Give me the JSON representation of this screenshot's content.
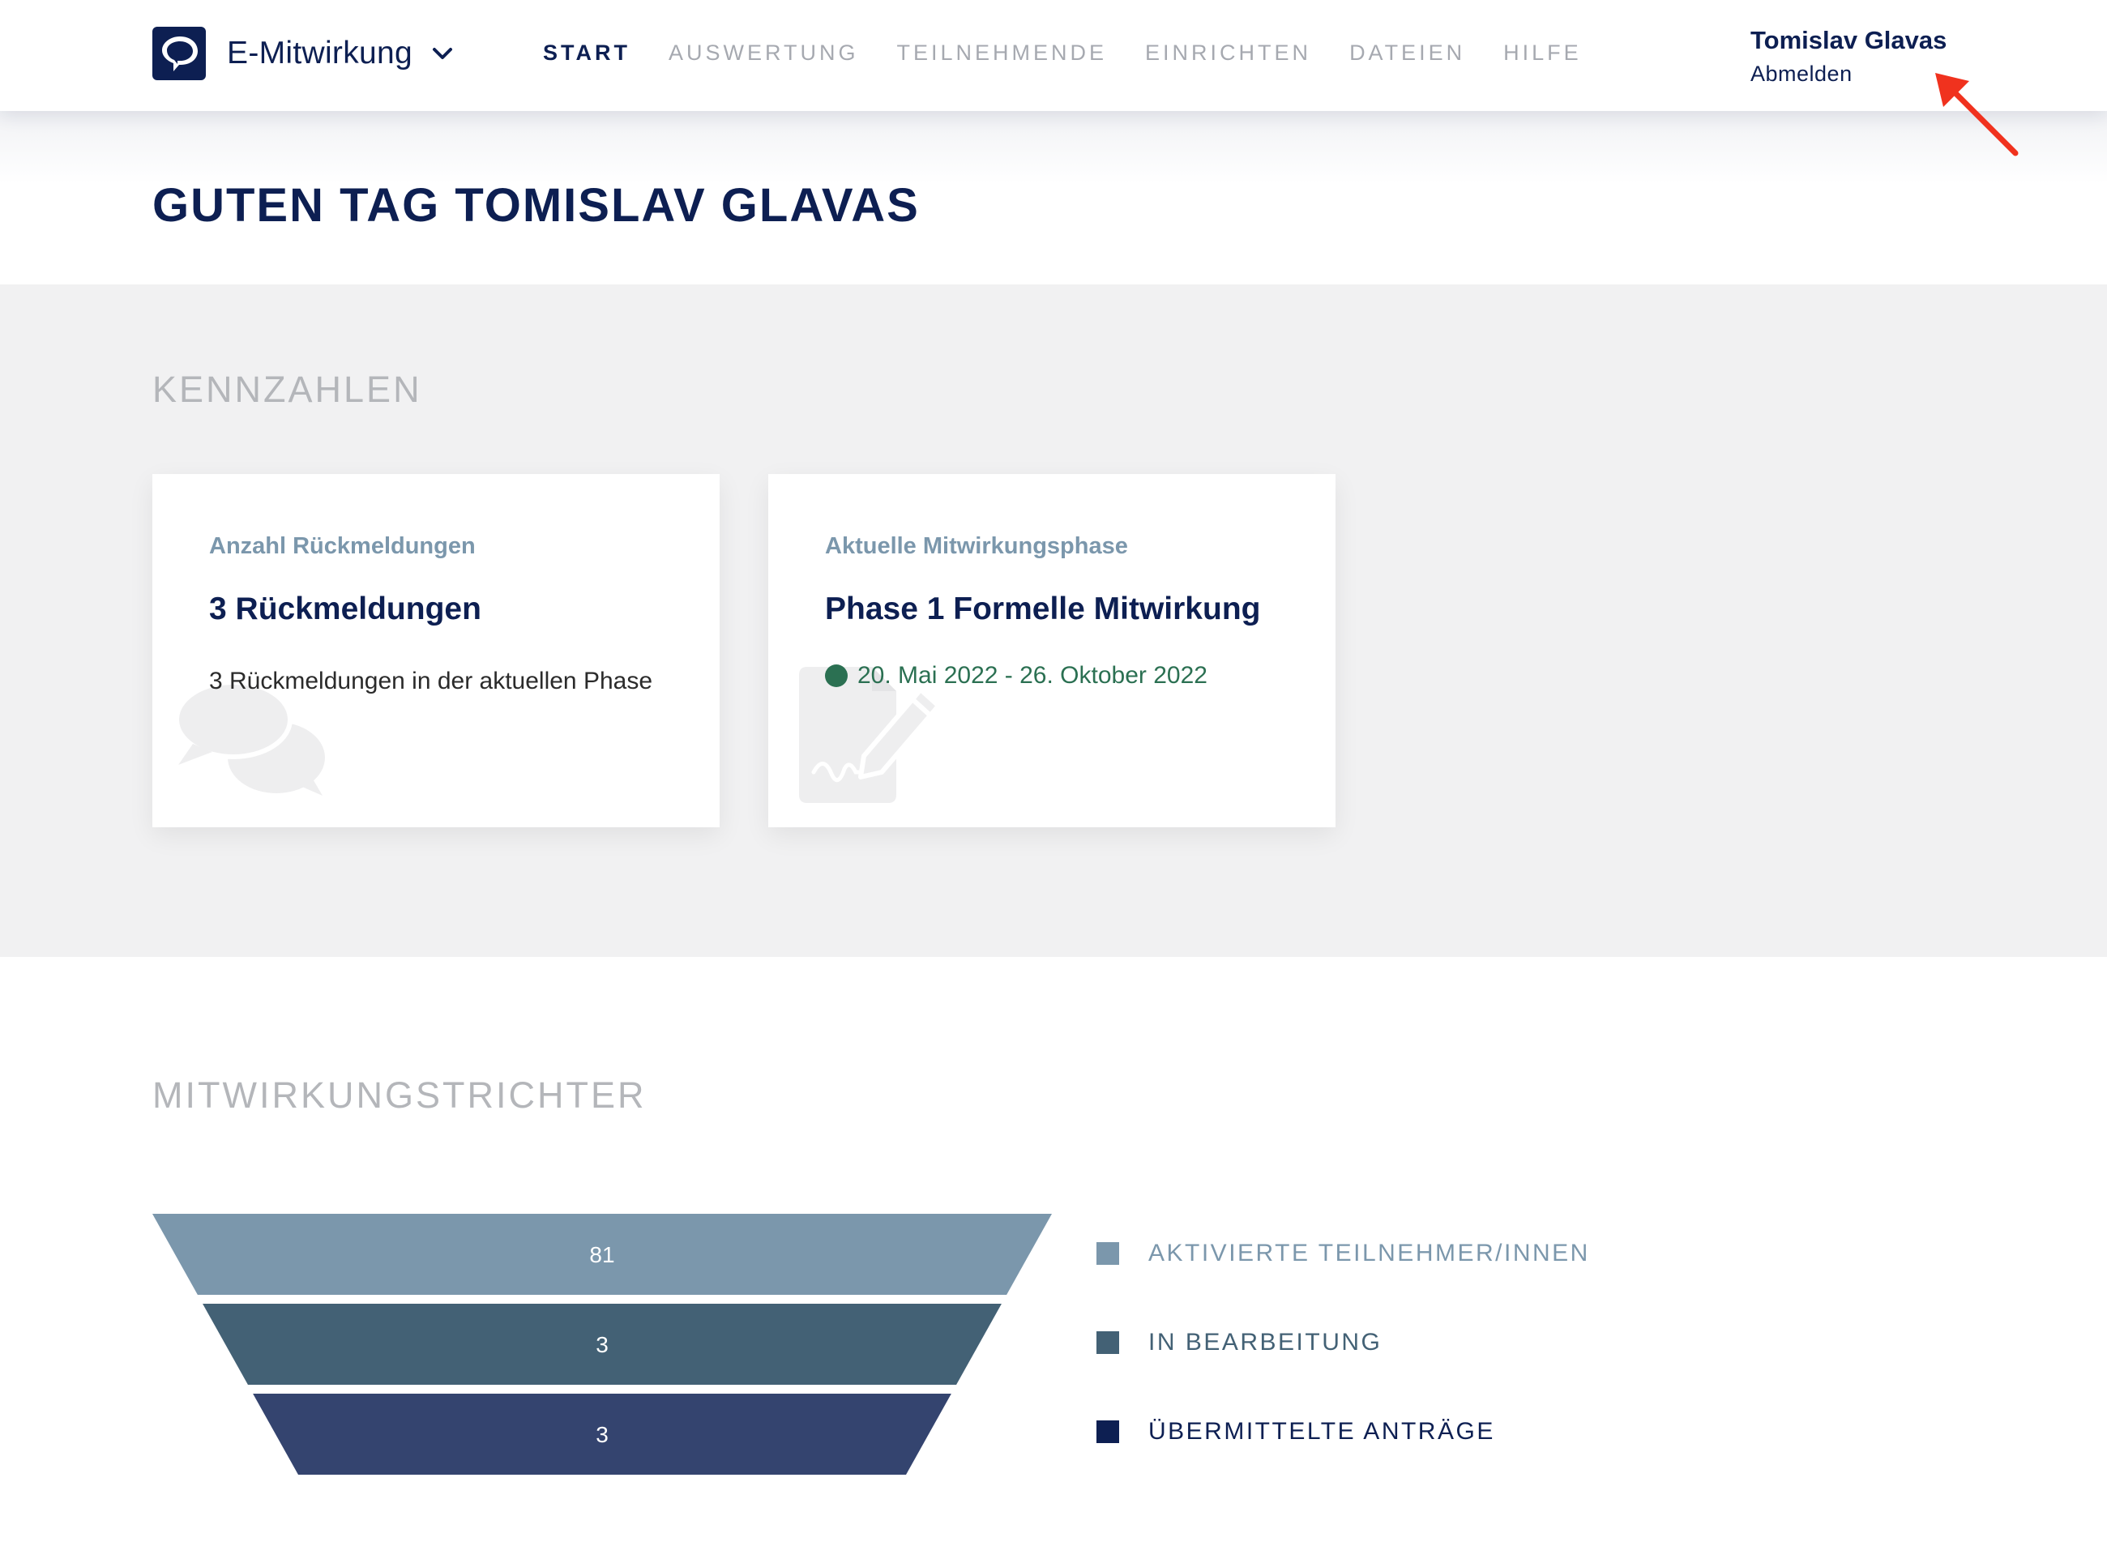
{
  "header": {
    "app_name": "E-Mitwirkung",
    "nav": [
      {
        "label": "START",
        "active": true
      },
      {
        "label": "AUSWERTUNG",
        "active": false
      },
      {
        "label": "TEILNEHMENDE",
        "active": false
      },
      {
        "label": "EINRICHTEN",
        "active": false
      },
      {
        "label": "DATEIEN",
        "active": false
      },
      {
        "label": "HILFE",
        "active": false
      }
    ],
    "user_name": "Tomislav Glavas",
    "logout_label": "Abmelden"
  },
  "greeting": "GUTEN TAG TOMISLAV GLAVAS",
  "kennzahlen": {
    "title": "KENNZAHLEN",
    "cards": [
      {
        "label": "Anzahl Rückmeldungen",
        "value": "3 Rückmeldungen",
        "description": "3 Rückmeldungen in der aktuellen Phase",
        "icon": "chat-bubbles-icon"
      },
      {
        "label": "Aktuelle Mitwirkungsphase",
        "value": "Phase 1 Formelle Mitwirkung",
        "status": "20. Mai 2022 - 26. Oktober 2022",
        "status_color": "#2b7052",
        "icon": "document-signature-icon"
      }
    ]
  },
  "trichter": {
    "title": "MITWIRKUNGSTRICHTER",
    "levels": [
      {
        "value": "81",
        "legend": "AKTIVIERTE TEILNEHMER/INNEN",
        "color": "#7b97ac"
      },
      {
        "value": "3",
        "legend": "IN BEARBEITUNG",
        "color": "#436175"
      },
      {
        "value": "3",
        "legend": "ÜBERMITTELTE ANTRÄGE",
        "color": "#34446f"
      }
    ],
    "legend_text_colors": [
      "#7b97ac",
      "#436175",
      "#0d1f52"
    ],
    "legend_swatch_colors": [
      "#7b97ac",
      "#436175",
      "#0d1f52"
    ]
  },
  "colors": {
    "primary": "#0d1f52",
    "accent_arrow": "#f0321e",
    "muted_heading": "#b4b6ba"
  }
}
